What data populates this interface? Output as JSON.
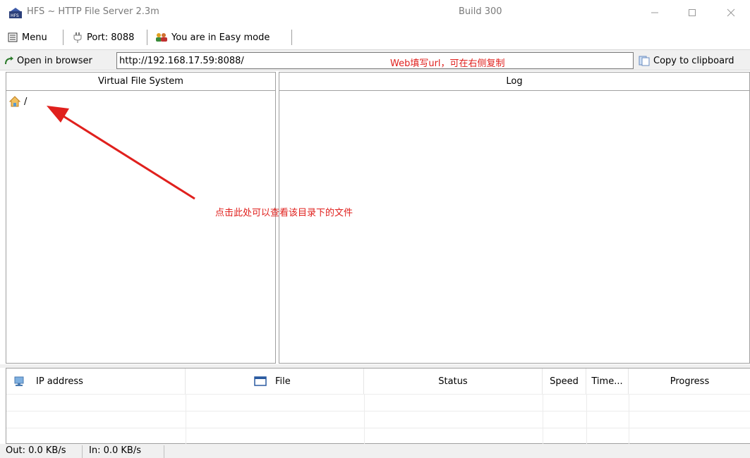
{
  "titlebar": {
    "title": "HFS ~ HTTP File Server 2.3m",
    "build": "Build 300",
    "minimize_icon": "minimize-icon",
    "maximize_icon": "maximize-icon",
    "close_icon": "close-icon"
  },
  "toolbar": {
    "menu_label": "Menu",
    "port_label": "Port: 8088",
    "mode_label": "You are in Easy mode"
  },
  "address": {
    "open_label": "Open in browser",
    "url": "http://192.168.17.59:8088/",
    "annotation": "Web填写url，可在右侧复制",
    "copy_label": "Copy to clipboard"
  },
  "vfs": {
    "header": "Virtual File System",
    "root_label": "/"
  },
  "log": {
    "header": "Log"
  },
  "annotation": {
    "arrow_text": "点击此处可以查看该目录下的文件"
  },
  "connections": {
    "columns": [
      "IP address",
      "File",
      "Status",
      "Speed",
      "Time...",
      "Progress"
    ]
  },
  "statusbar": {
    "out": "Out: 0.0 KB/s",
    "in": "In: 0.0 KB/s"
  },
  "colors": {
    "annotation": "#e0201d",
    "border": "#a0a0a0",
    "chrome": "#f0f0f0"
  }
}
